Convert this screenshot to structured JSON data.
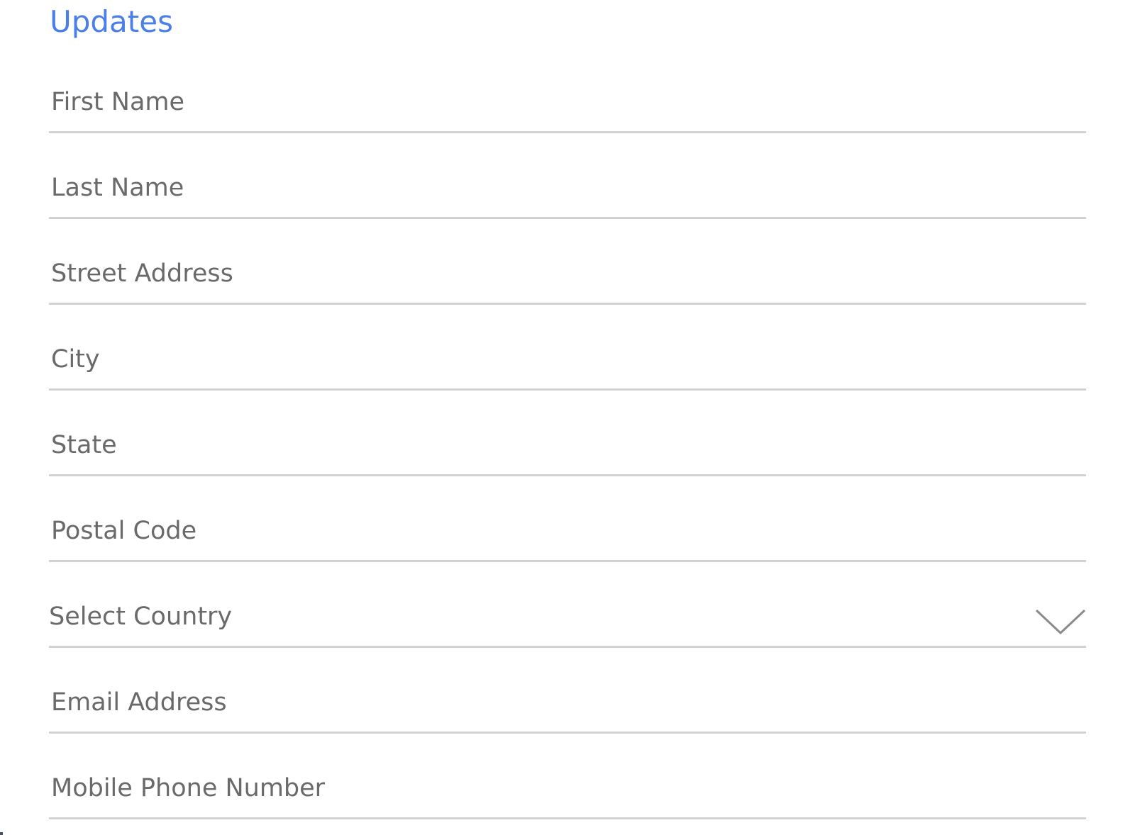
{
  "form": {
    "title": "Updates",
    "fields": {
      "first_name": {
        "placeholder": "First Name",
        "value": ""
      },
      "last_name": {
        "placeholder": "Last Name",
        "value": ""
      },
      "street_address": {
        "placeholder": "Street Address",
        "value": ""
      },
      "city": {
        "placeholder": "City",
        "value": ""
      },
      "state": {
        "placeholder": "State",
        "value": ""
      },
      "postal_code": {
        "placeholder": "Postal Code",
        "value": ""
      },
      "country": {
        "selected": "Select Country",
        "icon": "chevron-down-icon"
      },
      "email": {
        "placeholder": "Email Address",
        "value": ""
      },
      "mobile_phone": {
        "placeholder": "Mobile Phone Number",
        "value": ""
      }
    }
  },
  "colors": {
    "accent": "#4a7ee8",
    "text": "#6a6a6a",
    "underline": "#d2d2d2"
  }
}
